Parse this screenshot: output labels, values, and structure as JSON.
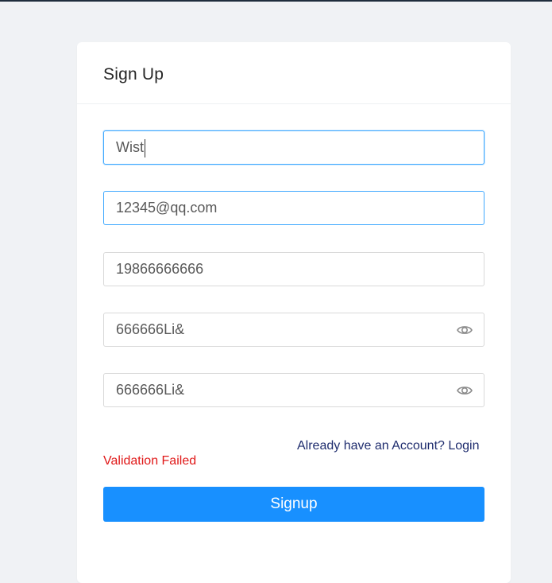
{
  "form": {
    "title": "Sign Up",
    "fields": [
      {
        "name": "username",
        "value": "Wist",
        "type": "text"
      },
      {
        "name": "email",
        "value": "12345@qq.com",
        "type": "text"
      },
      {
        "name": "phone",
        "value": "19866666666",
        "type": "text"
      },
      {
        "name": "password",
        "value": "666666Li&",
        "type": "text",
        "icon": "eye-icon"
      },
      {
        "name": "confirm_password",
        "value": "666666Li&",
        "type": "text",
        "icon": "eye-icon"
      }
    ],
    "login_link": "Already have an Account? Login",
    "validation_message": "Validation Failed",
    "submit_label": "Signup"
  },
  "colors": {
    "accent": "#1890ff",
    "error": "#e01818",
    "link": "#1f2d6e",
    "background": "#f0f2f5"
  }
}
